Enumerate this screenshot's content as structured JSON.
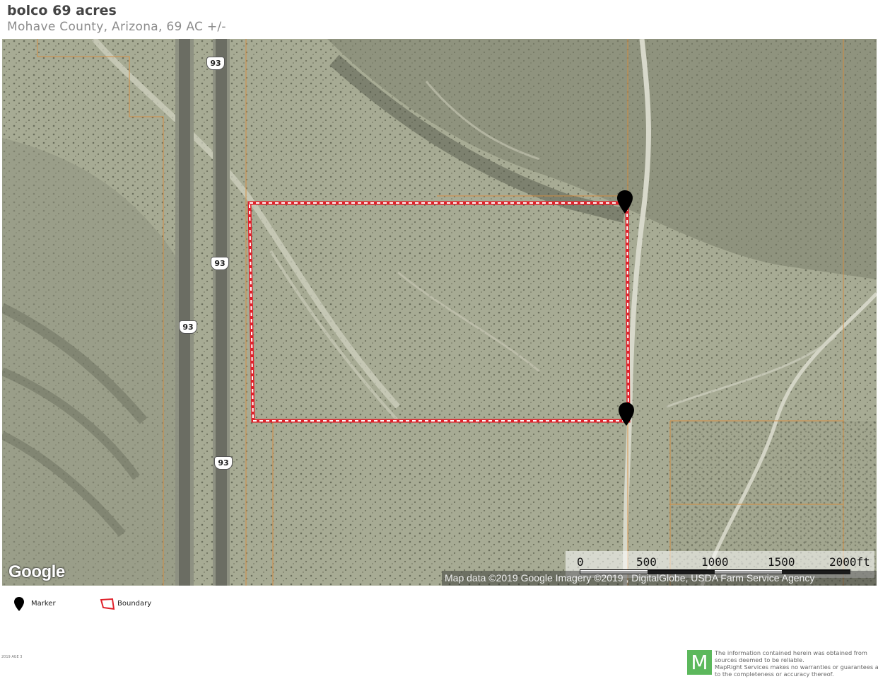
{
  "header": {
    "title": "bolco 69 acres",
    "subtitle": "Mohave County, Arizona, 69 AC +/-"
  },
  "map": {
    "highway_shields": [
      "93",
      "93",
      "93",
      "93"
    ],
    "google_logo": "Google",
    "attribution": "Map data ©2019 Google  Imagery ©2019 , DigitalGlobe, USDA Farm Service Agency",
    "scale_labels": [
      "0",
      "500",
      "1000",
      "1500",
      "2000ft"
    ],
    "boundary_color": "#e0202a",
    "parcel_line_color": "#d98b3a",
    "marker_icon": "map-pin-icon"
  },
  "legend": {
    "marker_label": "Marker",
    "boundary_label": "Boundary"
  },
  "footer": {
    "code": "2019 AGE 3",
    "logo_letter": "M",
    "disclaimer_lines": [
      "The information contained herein was obtained from",
      "sources deemed to be reliable.",
      "MapRight Services makes no warranties or guarantees as",
      "to the completeness or accuracy thereof."
    ]
  }
}
